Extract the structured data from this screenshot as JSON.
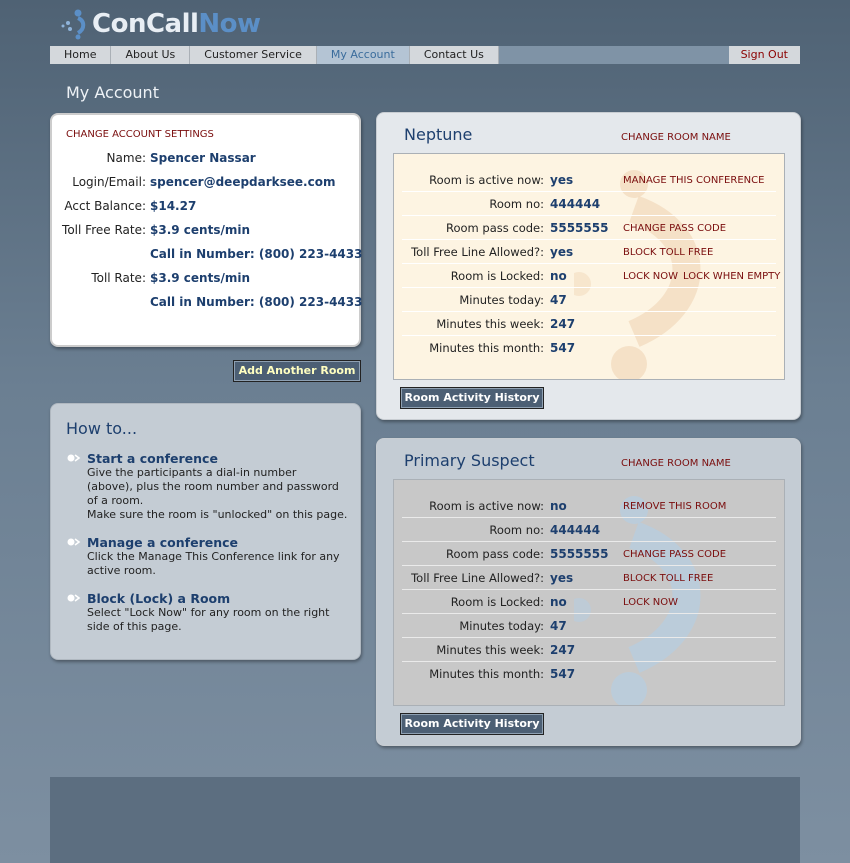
{
  "logo": {
    "part1": "ConCall",
    "part2": "Now"
  },
  "nav": {
    "items": [
      "Home",
      "About Us",
      "Customer Service",
      "My Account",
      "Contact Us"
    ],
    "active": "My Account",
    "signout": "Sign Out"
  },
  "page_title": "My Account",
  "account": {
    "heading": "CHANGE ACCOUNT SETTINGS",
    "name_label": "Name:",
    "name": "Spencer Nassar",
    "login_label": "Login/Email:",
    "login": "spencer@deepdarksee.com",
    "balance_label": "Acct Balance:",
    "balance": "$14.27",
    "tollfree_label": "Toll Free Rate:",
    "tollfree_rate": "$3.9 cents/min",
    "tollfree_number": "Call in Number: (800) 223-4433",
    "toll_label": "Toll Rate:",
    "toll_rate": "$3.9 cents/min",
    "toll_number": "Call in Number: (800) 223-4433"
  },
  "add_room_button": "Add Another Room",
  "howto": {
    "title": "How to...",
    "steps": [
      {
        "title": "Start a conference",
        "lines": [
          "Give the participants a dial-in number",
          "(above), plus the room number and password",
          "of a room.",
          "Make sure the room is \"unlocked\" on this page."
        ]
      },
      {
        "title": "Manage a conference",
        "lines": [
          "Click the Manage This Conference link for any",
          "active room."
        ]
      },
      {
        "title": "Block (Lock) a Room",
        "lines": [
          "Select \"Lock Now\" for any room on the right",
          "side of this page."
        ]
      }
    ]
  },
  "labels": {
    "active": "Room is active now:",
    "room_no": "Room no:",
    "pass": "Room pass code:",
    "tollfree": "Toll Free Line Allowed?:",
    "locked": "Room is Locked:",
    "today": "Minutes today:",
    "week": "Minutes this week:",
    "month": "Minutes this month:"
  },
  "rooms": [
    {
      "name": "Neptune",
      "change_name": "CHANGE ROOM NAME",
      "active": "yes",
      "active_action": "MANAGE THIS CONFERENCE",
      "room_no": "444444",
      "pass": "5555555",
      "pass_action": "CHANGE PASS CODE",
      "tollfree": "yes",
      "tollfree_action": "BLOCK TOLL FREE",
      "locked": "no",
      "lock_action": "LOCK NOW",
      "lock_action2": "LOCK WHEN EMPTY",
      "today": "47",
      "week": "247",
      "month": "547",
      "history_button": "Room Activity History"
    },
    {
      "name": "Primary Suspect",
      "change_name": "CHANGE ROOM NAME",
      "active": "no",
      "active_action": "REMOVE THIS ROOM",
      "room_no": "444444",
      "pass": "5555555",
      "pass_action": "CHANGE PASS CODE",
      "tollfree": "yes",
      "tollfree_action": "BLOCK TOLL FREE",
      "locked": "no",
      "lock_action": "LOCK NOW",
      "today": "47",
      "week": "247",
      "month": "547",
      "history_button": "Room Activity History"
    }
  ],
  "colors": {
    "brand_dark": "#1d3f6e",
    "action_red": "#7a0d0d",
    "brand_light": "#5b8fc7"
  }
}
